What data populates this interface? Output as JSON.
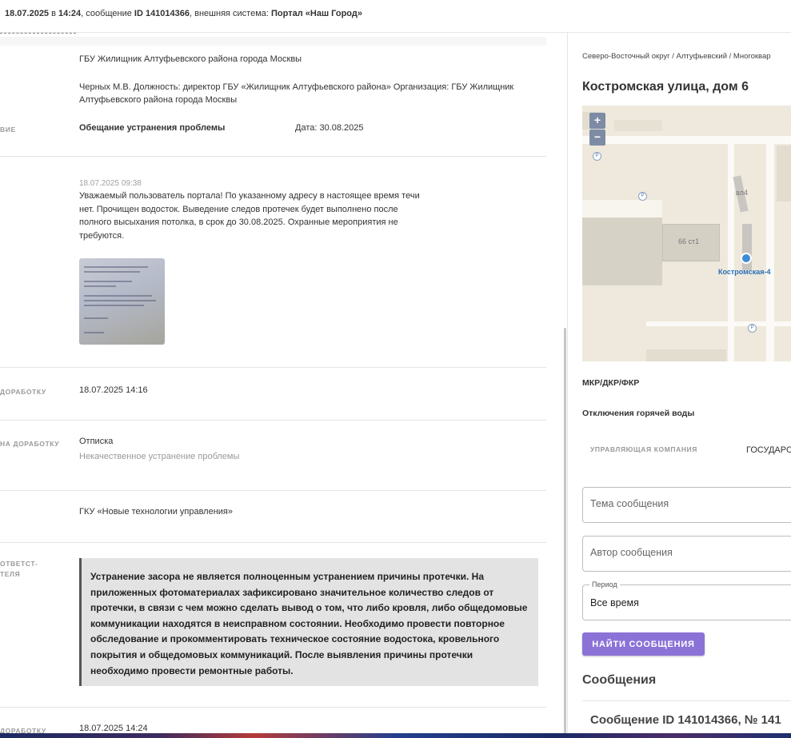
{
  "header": {
    "date": "18.07.2025",
    "in_word": " в ",
    "time": "14:24",
    "message_word": ", сообщение ",
    "message_id": "ID 141014366",
    "system_word": ", внешняя система: ",
    "system_name": "Портал «Наш Город»"
  },
  "details": {
    "org": "ГБУ Жилищник Алтуфьевского района города Москвы",
    "person": "Черных М.В. Должность: директор ГБУ «Жилищник Алтуфьевского района» Организация: ГБУ Жилищник Алтуфьевского района города Москвы",
    "action_label": "ВИЕ",
    "action_value": "Обещание устранения проблемы",
    "action_date": "Дата: 30.08.2025",
    "reply_timestamp": "18.07.2025 09:38",
    "reply_text": "Уважаемый пользователь портала! По указанному адресу в настоящее время течи нет. Прочищен водосток. Выведение следов протечек будет выполнено после полного высыхания потолка, в срок до 30.08.2025. Охранные мероприятия не требуются.",
    "rework_date_label": "ДОРАБОТКУ",
    "rework_date": "18.07.2025 14:16",
    "rework_reason_label": "НА ДОРАБОТКУ",
    "rework_reason": "Отписка",
    "rework_reason_sub": "Некачественное устранение проблемы",
    "agency": "ГКУ «Новые технологии управления»",
    "responsible_label_1": "ОТВЕТСТ-",
    "responsible_label_2": "ТЕЛЯ",
    "comment": "Устранение засора не является полноценным устранением причины протечки. На приложенных фотоматериалах зафиксировано значительное количество следов от протечки, в связи с чем можно сделать вывод о том, что либо кровля, либо общедомовые коммуникации находятся в неисправном состоянии. Необходимо провести повторное обследование и прокомментировать техническое состояние водостока, кровельного покрытия и общедомовых коммуникаций. После выявления причины протечки необходимо провести ремонтные работы.",
    "last_label": "ДОРАБОТКУ",
    "last_date": "18.07.2025 14:24"
  },
  "sidebar": {
    "breadcrumb": "Северо-Восточный округ / Алтуфьевский / Многоквар",
    "address": "Костромская улица, дом 6",
    "map": {
      "zoom_in": "+",
      "zoom_out": "−",
      "label_street": "Костромская-4",
      "label_building": "66 ст1",
      "label_vl": "вл4",
      "parking": "P"
    },
    "mkr": "МКР/ДКР/ФКР",
    "hot_water": "Отключения горячей воды",
    "uk_label": "УПРАВЛЯЮЩАЯ КОМПАНИЯ",
    "uk_value": "ГОСУДАРС",
    "topic_placeholder": "Тема сообщения",
    "author_placeholder": "Автор сообщения",
    "period_legend": "Период",
    "period_value": "Все время",
    "search_button": "НАЙТИ СООБЩЕНИЯ",
    "messages_title": "Сообщения",
    "message_card": "Сообщение ID 141014366, № 141"
  },
  "colors": {
    "accent_button": "#8b72d6",
    "quote_bg": "#e3e3e3",
    "map_pin": "#3f8ad6"
  }
}
